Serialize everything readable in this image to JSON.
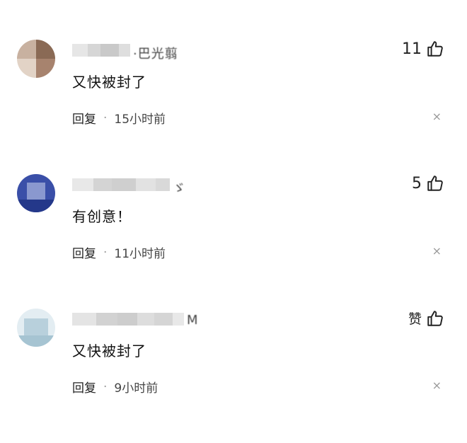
{
  "comments": [
    {
      "name_tail": "·巴光翦",
      "likes": "11",
      "text": "又快被封了",
      "reply_label": "回复",
      "time": "15小时前",
      "avatar_colors": [
        "#b79b86",
        "#7c5c48",
        "#d9c6b7",
        "#a78672"
      ]
    },
    {
      "name_tail": "ゞ",
      "likes": "5",
      "text": "有创意！",
      "reply_label": "回复",
      "time": "11小时前",
      "avatar_colors": [
        "#3a4fa8",
        "#6b7fc5",
        "#9aa7d8",
        "#24388a"
      ]
    },
    {
      "name_tail": "M",
      "likes": "赞",
      "text": "又快被封了",
      "reply_label": "回复",
      "time": "9小时前",
      "avatar_colors": [
        "#cfe0e8",
        "#a8c6d4",
        "#e8eff3",
        "#9ec0cf"
      ]
    }
  ],
  "icons": {
    "like": "thumbs-up-icon",
    "dismiss": "close-icon",
    "dismiss_glyph": "×",
    "separator": "·"
  }
}
